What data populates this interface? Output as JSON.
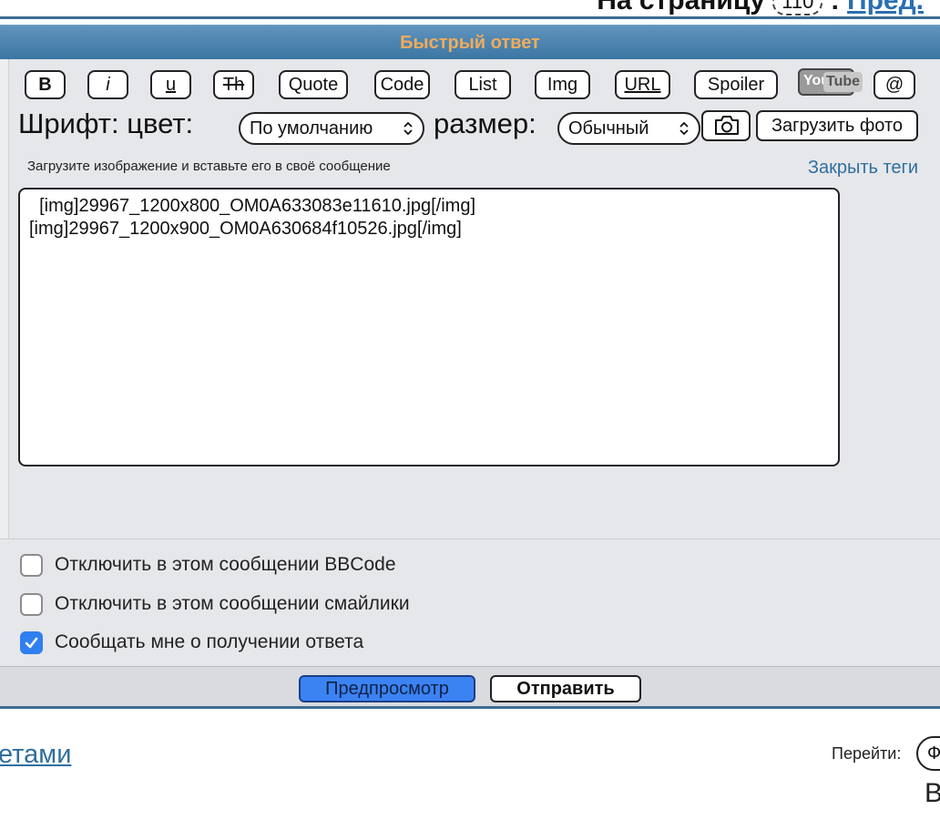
{
  "page_nav": {
    "label": "На страницу",
    "page_box": "110",
    "prev_link": "Пред."
  },
  "header": {
    "title": "Быстрый ответ"
  },
  "toolbar": {
    "bold": "B",
    "italic": "i",
    "underline": "u",
    "strike": "Th",
    "quote": "Quote",
    "code": "Code",
    "list": "List",
    "img": "Img",
    "url": "URL",
    "spoiler": "Spoiler",
    "youtube_you": "You",
    "youtube_tube": "Tube",
    "mention": "@"
  },
  "font_row": {
    "label": "Шрифт: цвет:",
    "color_value": "По умолчанию",
    "size_label": "размер:",
    "size_value": "Обычный",
    "camera_icon": "camera-icon",
    "upload_label": "Загрузить фото"
  },
  "hint": "Загрузите изображение и вставьте его в своё сообщение",
  "close_tags": "Закрыть теги",
  "message": {
    "text": "  [img]29967_1200x800_OM0A633083e11610.jpg[/img]\n[img]29967_1200x900_OM0A630684f10526.jpg[/img]"
  },
  "options": [
    {
      "label": "Отключить в этом сообщении BBCode",
      "checked": false
    },
    {
      "label": "Отключить в этом сообщении смайлики",
      "checked": false
    },
    {
      "label": "Сообщать мне о получении ответа",
      "checked": true
    }
  ],
  "actions": {
    "preview": "Предпросмотр",
    "send": "Отправить"
  },
  "footer": {
    "link_fragment": "етами",
    "goto_label": "Перейти:",
    "goto_value": "Ф",
    "trailing_letter": "В"
  },
  "colors": {
    "header_bg": "#4a82ad",
    "header_title": "#f0ab5c",
    "panel_bg": "#e6e7ea",
    "accent_blue": "#2f7ff0",
    "link": "#2f6f9f"
  }
}
